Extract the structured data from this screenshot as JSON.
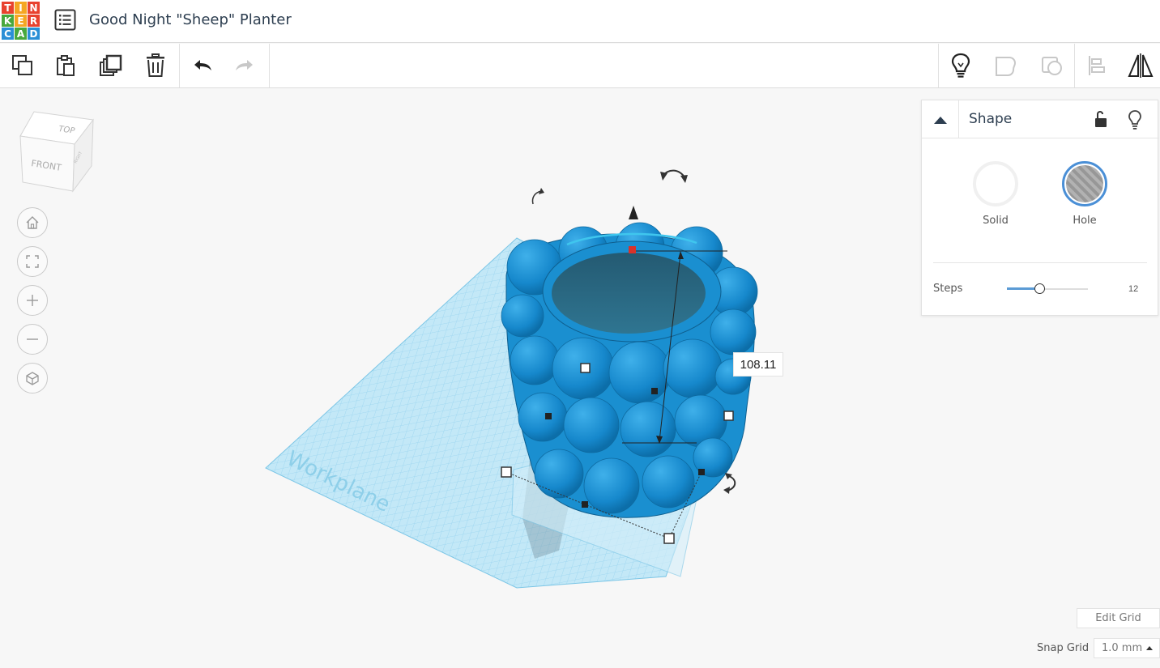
{
  "header": {
    "logo_letters": [
      "T",
      "I",
      "N",
      "K",
      "E",
      "R",
      "C",
      "A",
      "D"
    ],
    "logo_colors": [
      "#e8422f",
      "#f5a623",
      "#e8422f",
      "#48a83e",
      "#f5a623",
      "#e8422f",
      "#2a8fd6",
      "#48a83e",
      "#2a8fd6"
    ],
    "design_title": "Good Night \"Sheep\" Planter"
  },
  "toolbar": {
    "left": [
      "copy-icon",
      "paste-icon",
      "duplicate-icon",
      "delete-icon",
      "undo-icon",
      "redo-icon"
    ],
    "right": [
      "lightbulb-icon",
      "note-icon",
      "group-icon",
      "align-icon",
      "mirror-icon"
    ]
  },
  "viewcube": {
    "top": "TOP",
    "front": "FRONT",
    "right": "RIGHT"
  },
  "nav": [
    "home-icon",
    "fit-view-icon",
    "zoom-in-icon",
    "zoom-out-icon",
    "perspective-icon"
  ],
  "scene": {
    "workplane_label": "Workplane",
    "dimension_value": "108.11",
    "shape_color": "#1a8fd0"
  },
  "panel": {
    "title": "Shape",
    "solid_label": "Solid",
    "hole_label": "Hole",
    "selected": "Hole",
    "steps_label": "Steps",
    "steps_value": "12",
    "steps_fraction": 0.4
  },
  "grid": {
    "edit_label": "Edit Grid",
    "snap_label": "Snap Grid",
    "snap_value": "1.0 mm"
  }
}
